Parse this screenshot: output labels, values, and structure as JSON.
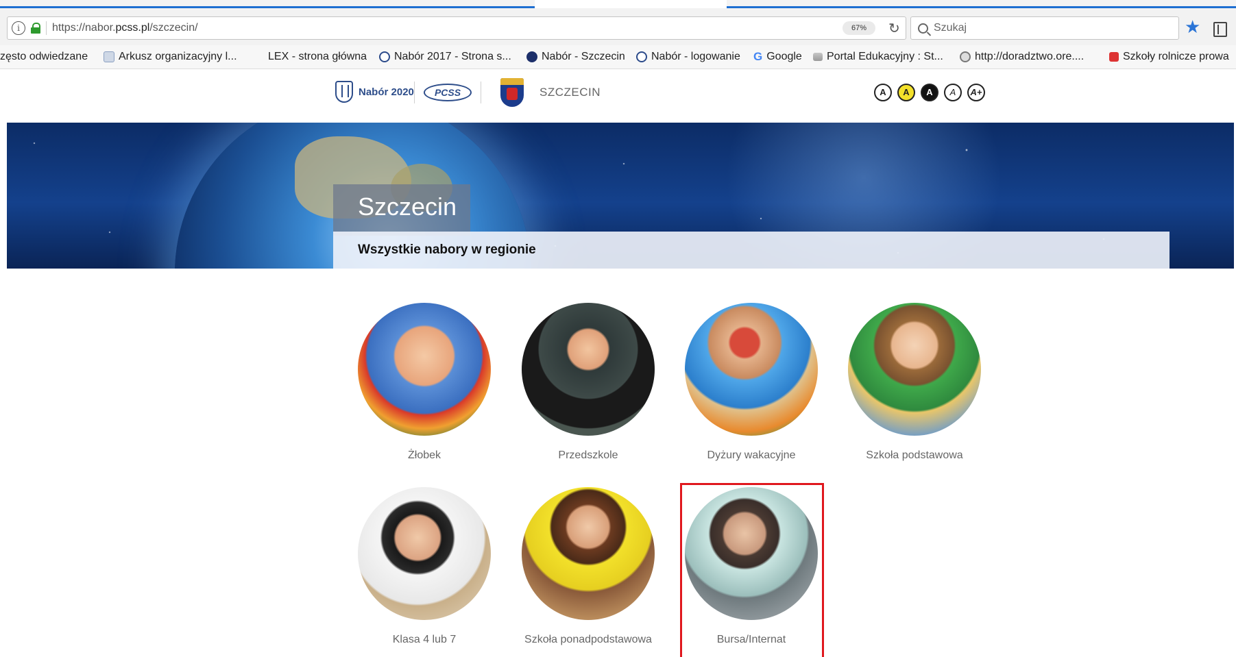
{
  "browser": {
    "url_prefix": "https://nabor.",
    "url_domain": "pcss.pl",
    "url_path": "/szczecin/",
    "zoom": "67%",
    "search_placeholder": "Szukaj"
  },
  "bookmarks": [
    {
      "label": "zęsto odwiedzane",
      "icon": "none"
    },
    {
      "label": "Arkusz organizacyjny l...",
      "icon": "doc-icon"
    },
    {
      "label": "LEX - strona główna",
      "icon": "none"
    },
    {
      "label": "Nabór 2017 - Strona s...",
      "icon": "nabor-icon"
    },
    {
      "label": "Nabór - Szczecin",
      "icon": "nabor-dark-icon"
    },
    {
      "label": "Nabór - logowanie",
      "icon": "nabor-icon"
    },
    {
      "label": "Google",
      "icon": "google-icon"
    },
    {
      "label": "Portal Edukacyjny : St...",
      "icon": "portal-icon"
    },
    {
      "label": "http://doradztwo.ore....",
      "icon": "globe-icon"
    },
    {
      "label": "Szkoły rolnicze prowa",
      "icon": "red-icon"
    }
  ],
  "header": {
    "nabor_logo": "Nabór 2020",
    "pcss_logo": "PCSS",
    "city": "SZCZECIN",
    "contrast_buttons": [
      "A",
      "A",
      "A",
      "A",
      "A+"
    ]
  },
  "hero": {
    "title": "Szczecin",
    "subtitle": "Wszystkie nabory w regionie"
  },
  "tiles": [
    {
      "label": "Żłobek"
    },
    {
      "label": "Przedszkole"
    },
    {
      "label": "Dyżury wakacyjne"
    },
    {
      "label": "Szkoła podstawowa"
    },
    {
      "label": "Klasa 4 lub 7"
    },
    {
      "label": "Szkoła ponadpodstawowa"
    },
    {
      "label": "Bursa/Internat"
    }
  ],
  "colors": {
    "highlight": "#e0181e",
    "brand": "#2d4d8a",
    "star": "#2a74d6"
  }
}
